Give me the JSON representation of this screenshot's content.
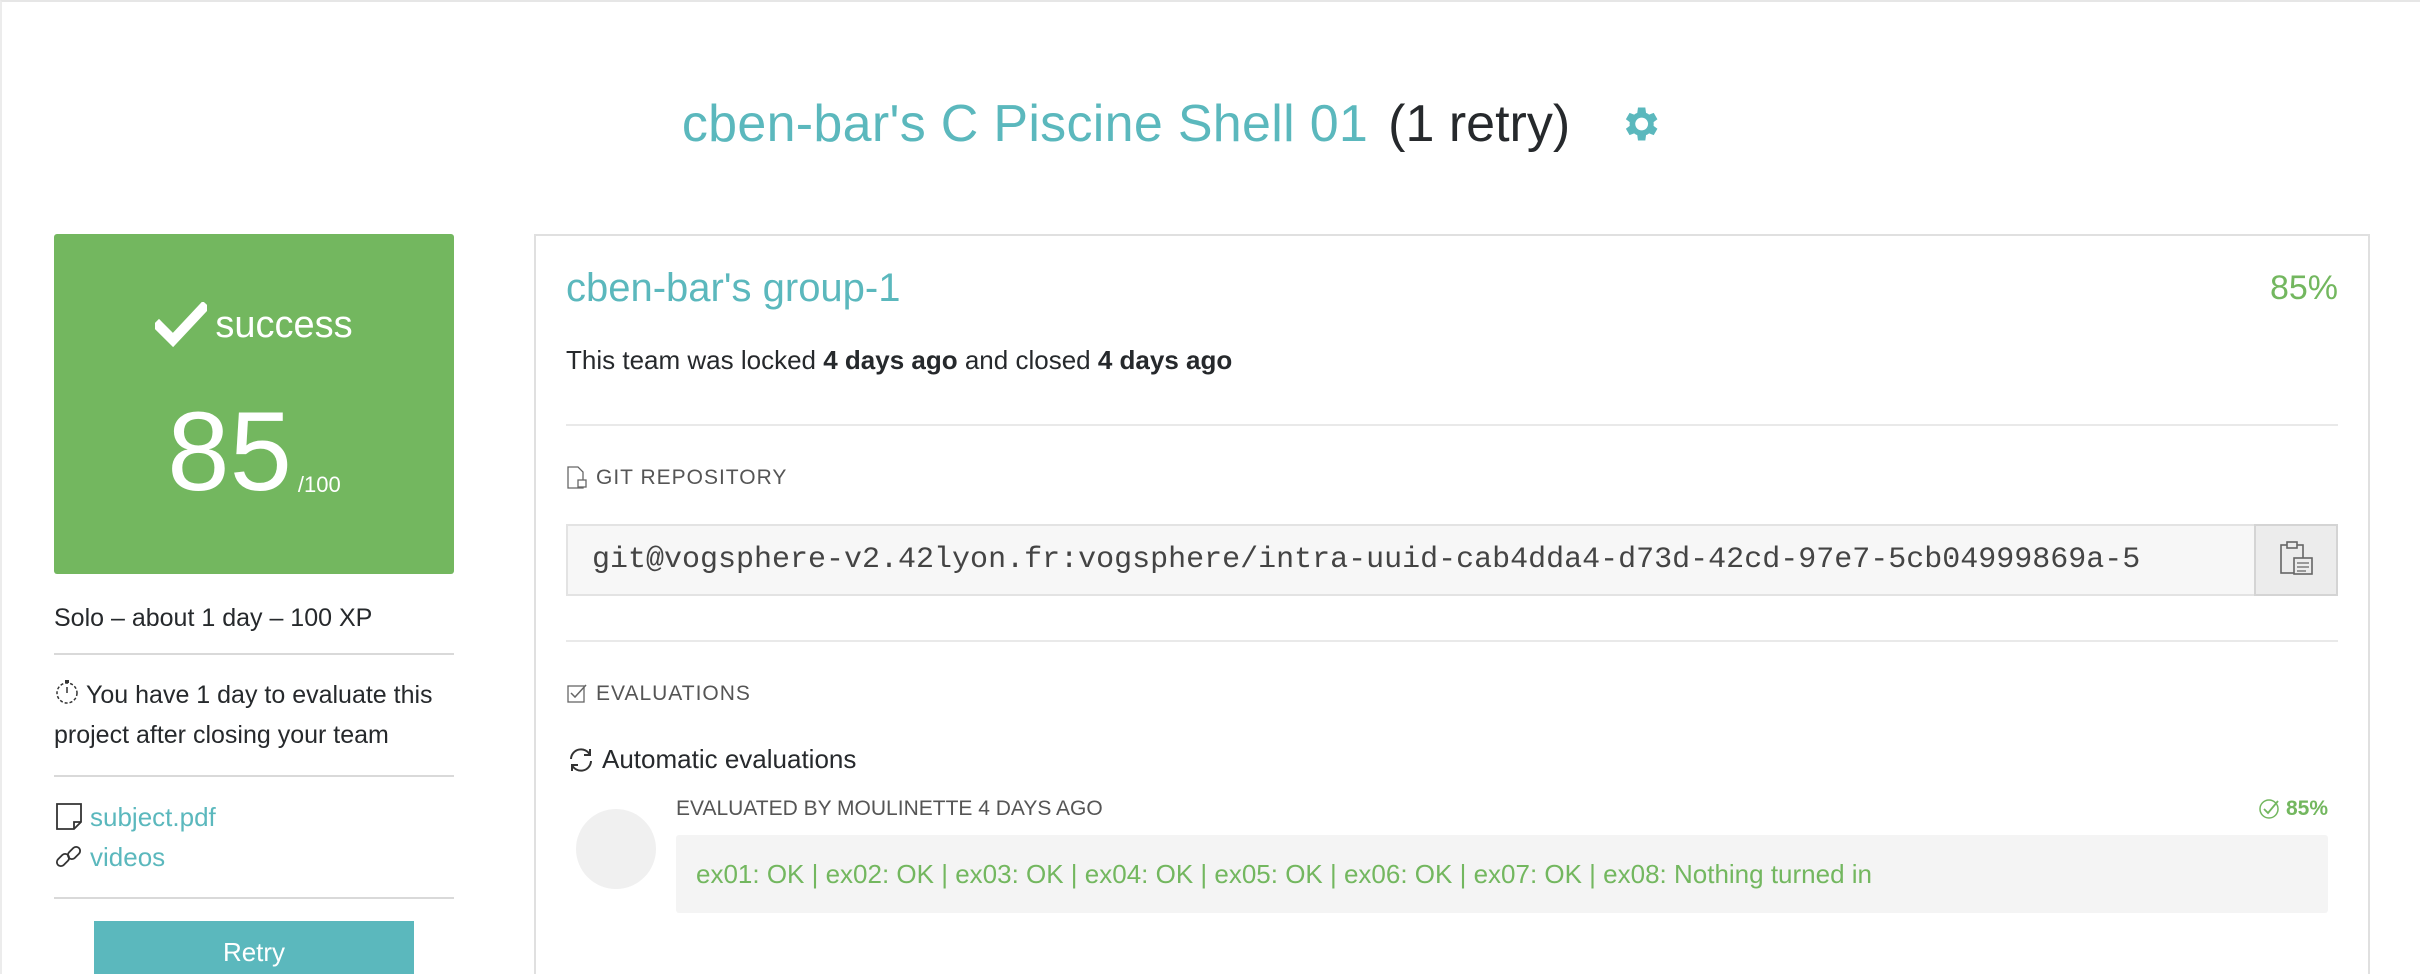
{
  "header": {
    "project_title": "cben-bar's C Piscine Shell 01",
    "retry_count": "(1 retry)",
    "settings_icon": "gear-icon"
  },
  "status": {
    "label": "success",
    "score": "85",
    "max": "/100",
    "color": "#73b75f"
  },
  "sidebar": {
    "meta": "Solo – about 1 day – 100 XP",
    "evaluate_notice": "You have 1 day to evaluate this project after closing your team",
    "links": [
      {
        "label": "subject.pdf",
        "icon": "document-icon"
      },
      {
        "label": "videos",
        "icon": "link-icon"
      }
    ],
    "retry_label": "Retry"
  },
  "team": {
    "name": "cben-bar's group-1",
    "percent": "85%",
    "lock_prefix": "This team was locked ",
    "locked_ago": "4 days ago",
    "lock_middle": " and closed ",
    "closed_ago": "4 days ago"
  },
  "repository": {
    "section_title": "GIT REPOSITORY",
    "url": "git@vogsphere-v2.42lyon.fr:vogsphere/intra-uuid-cab4dda4-d73d-42cd-97e7-5cb04999869a-5"
  },
  "evaluations": {
    "section_title": "EVALUATIONS",
    "automatic_title": "Automatic evaluations",
    "items": [
      {
        "header": "EVALUATED BY MOULINETTE 4 DAYS AGO",
        "score": "85%",
        "result": "ex01: OK | ex02: OK | ex03: OK | ex04: OK | ex05: OK | ex06: OK | ex07: OK | ex08: Nothing turned in"
      }
    ]
  },
  "colors": {
    "accent": "#5bb8bd",
    "success": "#73b75f",
    "text": "#26292c"
  }
}
